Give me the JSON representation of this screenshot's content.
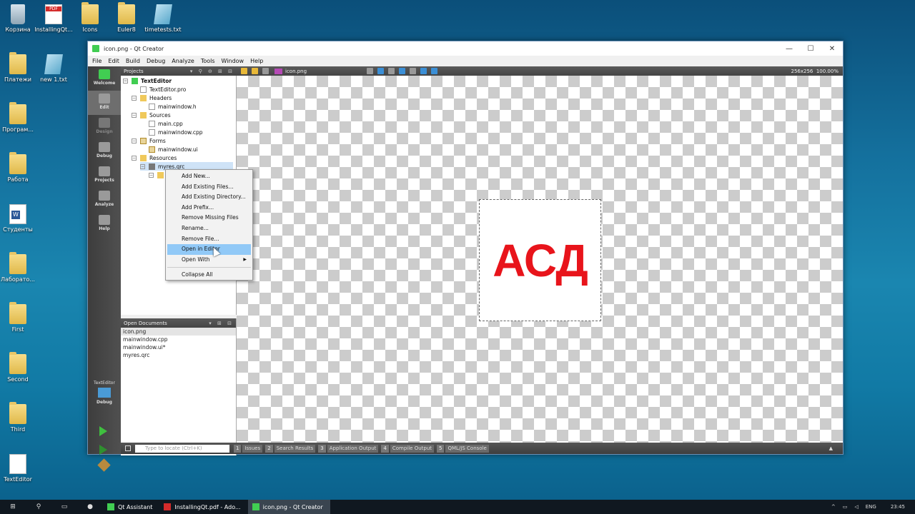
{
  "desktop": {
    "icons": [
      {
        "label": "Корзина"
      },
      {
        "label": "InstallingQt..."
      },
      {
        "label": "Icons"
      },
      {
        "label": "Euler8"
      },
      {
        "label": "timetests.txt"
      },
      {
        "label": "Платежи"
      },
      {
        "label": "new 1.txt"
      },
      {
        "label": "Програм..."
      },
      {
        "label": "Работа"
      },
      {
        "label": "Студенты"
      },
      {
        "label": "Лаборато..."
      },
      {
        "label": "First"
      },
      {
        "label": "Second"
      },
      {
        "label": "Third"
      },
      {
        "label": "TextEditor"
      }
    ],
    "pdf_badge": "PDF"
  },
  "window": {
    "title": "icon.png - Qt Creator",
    "controls": {
      "minimize": "—",
      "maximize": "☐",
      "close": "✕"
    }
  },
  "menubar": [
    "File",
    "Edit",
    "Build",
    "Debug",
    "Analyze",
    "Tools",
    "Window",
    "Help"
  ],
  "modes": [
    {
      "label": "Welcome"
    },
    {
      "label": "Edit"
    },
    {
      "label": "Design"
    },
    {
      "label": "Debug"
    },
    {
      "label": "Projects"
    },
    {
      "label": "Analyze"
    },
    {
      "label": "Help"
    }
  ],
  "kit": {
    "project": "TextEditor",
    "config": "Debug"
  },
  "projects_panel": {
    "title": "Projects",
    "tree": [
      {
        "label": "TextEditor"
      },
      {
        "label": "TextEditor.pro"
      },
      {
        "label": "Headers"
      },
      {
        "label": "mainwindow.h"
      },
      {
        "label": "Sources"
      },
      {
        "label": "main.cpp"
      },
      {
        "label": "mainwindow.cpp"
      },
      {
        "label": "Forms"
      },
      {
        "label": "mainwindow.ui"
      },
      {
        "label": "Resources"
      },
      {
        "label": "myres.qrc"
      }
    ]
  },
  "context_menu": {
    "items": [
      {
        "label": "Add New..."
      },
      {
        "label": "Add Existing Files..."
      },
      {
        "label": "Add Existing Directory..."
      },
      {
        "label": "Add Prefix..."
      },
      {
        "label": "Remove Missing Files"
      },
      {
        "label": "Rename..."
      },
      {
        "label": "Remove File..."
      },
      {
        "label": "Open in Editor"
      },
      {
        "label": "Open With"
      },
      {
        "label": "Collapse All"
      }
    ],
    "highlighted": "Open in Editor"
  },
  "open_documents": {
    "title": "Open Documents",
    "files": [
      "icon.png",
      "mainwindow.cpp",
      "mainwindow.ui*",
      "myres.qrc"
    ]
  },
  "editor": {
    "file": "icon.png",
    "size": "256x256",
    "zoom": "100.00%",
    "image_text": "АСД"
  },
  "statusbar": {
    "locate_placeholder": "Type to locate (Ctrl+K)",
    "panes": [
      {
        "num": "1",
        "label": "Issues"
      },
      {
        "num": "2",
        "label": "Search Results"
      },
      {
        "num": "3",
        "label": "Application Output"
      },
      {
        "num": "4",
        "label": "Compile Output"
      },
      {
        "num": "5",
        "label": "QML/JS Console"
      }
    ]
  },
  "taskbar": {
    "apps": [
      {
        "label": "Qt Assistant"
      },
      {
        "label": "InstallingQt.pdf - Ado..."
      },
      {
        "label": "icon.png - Qt Creator"
      }
    ],
    "lang": "ENG",
    "time": "23:45"
  }
}
